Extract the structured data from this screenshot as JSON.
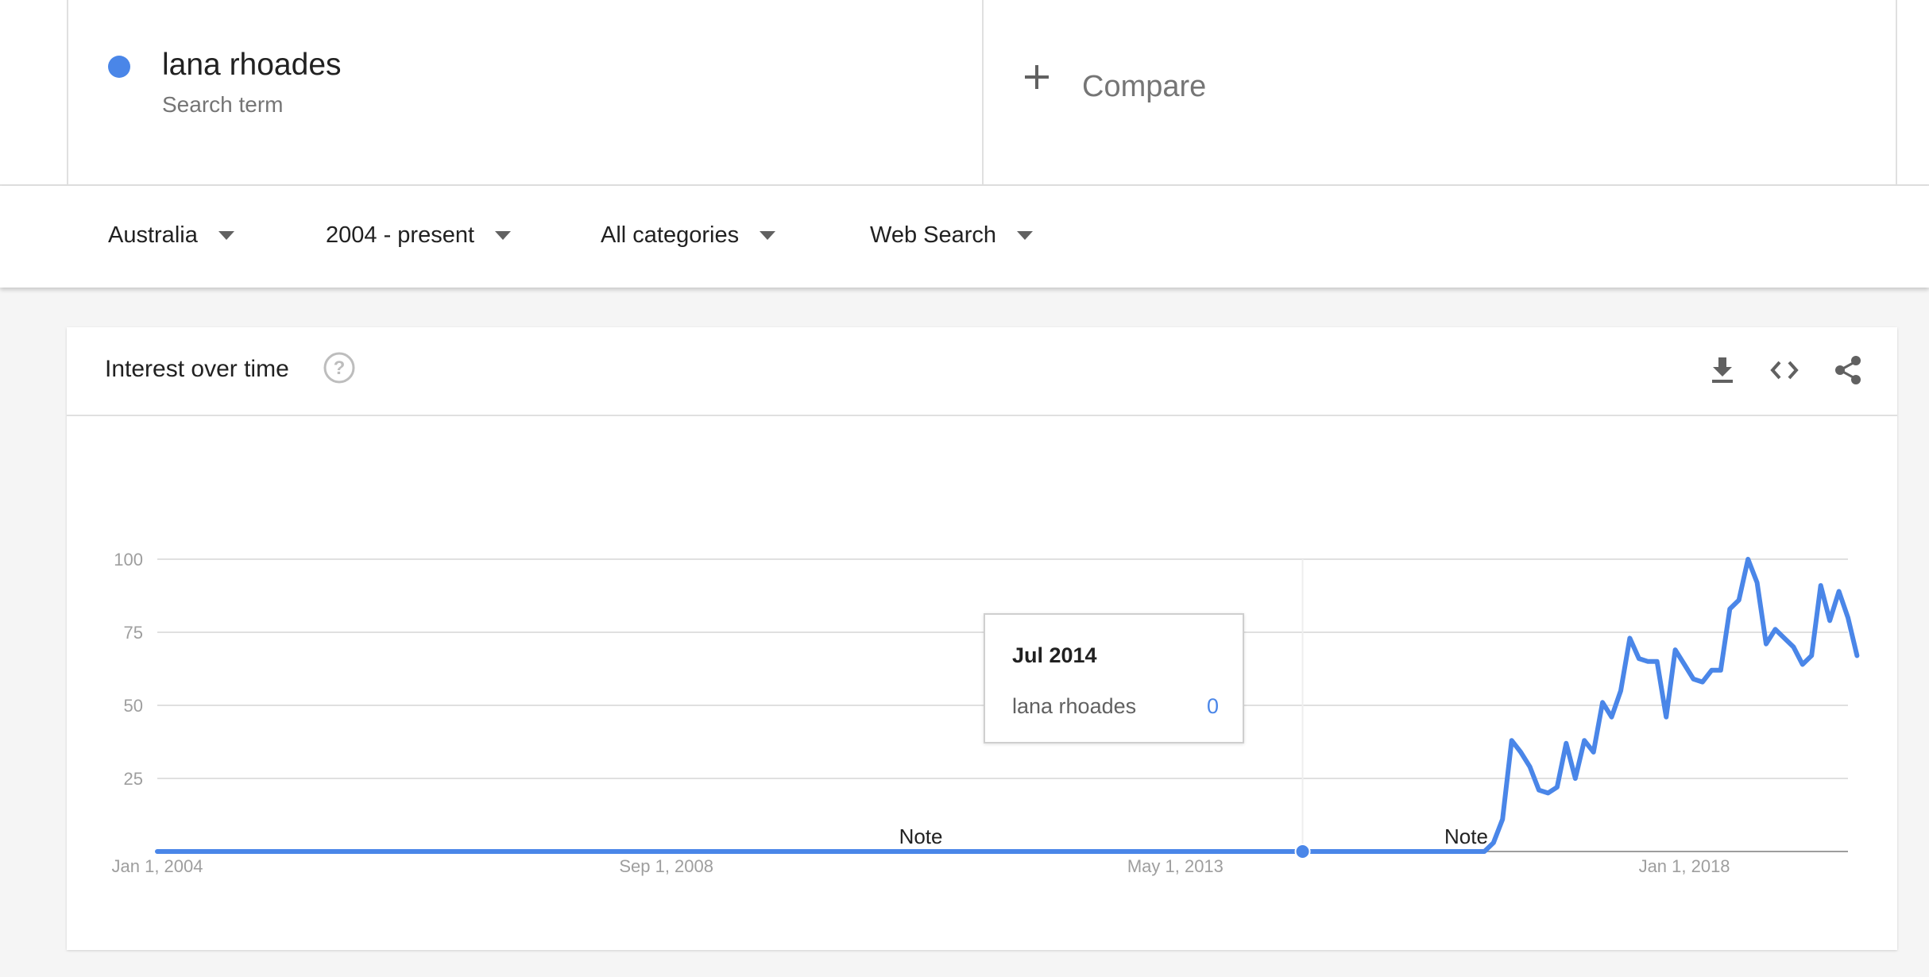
{
  "search_term": {
    "name": "lana rhoades",
    "subtitle": "Search term",
    "color": "#4a86e8"
  },
  "compare": {
    "label": "Compare"
  },
  "filters": {
    "region": "Australia",
    "time_range": "2004 - present",
    "category": "All categories",
    "search_type": "Web Search"
  },
  "card": {
    "title": "Interest over time",
    "icons": [
      "help-icon",
      "download-icon",
      "embed-code-icon",
      "share-icon"
    ]
  },
  "tooltip": {
    "date": "Jul 2014",
    "term": "lana rhoades",
    "value": "0"
  },
  "chart_data": {
    "type": "line",
    "title": "",
    "xlabel": "",
    "ylabel": "",
    "ylim": [
      0,
      100
    ],
    "yticks": [
      25,
      50,
      75,
      100
    ],
    "xticks": [
      "Jan 1, 2004",
      "Sep 1, 2008",
      "May 1, 2013",
      "Jan 1, 2018"
    ],
    "xrange": [
      "2004-01",
      "2019-04"
    ],
    "grid": true,
    "notes": [
      {
        "label": "Note",
        "date": "2011-01"
      },
      {
        "label": "Note",
        "date": "2016-01"
      }
    ],
    "highlight": {
      "date": "2014-07",
      "value": 0
    },
    "series": [
      {
        "name": "lana rhoades",
        "color": "#4a86e8",
        "points": [
          [
            "2004-01",
            0
          ],
          [
            "2016-02",
            0
          ],
          [
            "2016-03",
            0
          ],
          [
            "2016-04",
            3
          ],
          [
            "2016-05",
            11
          ],
          [
            "2016-06",
            38
          ],
          [
            "2016-07",
            34
          ],
          [
            "2016-08",
            29
          ],
          [
            "2016-09",
            21
          ],
          [
            "2016-10",
            20
          ],
          [
            "2016-11",
            22
          ],
          [
            "2016-12",
            37
          ],
          [
            "2017-01",
            25
          ],
          [
            "2017-02",
            38
          ],
          [
            "2017-03",
            34
          ],
          [
            "2017-04",
            51
          ],
          [
            "2017-05",
            46
          ],
          [
            "2017-06",
            55
          ],
          [
            "2017-07",
            73
          ],
          [
            "2017-08",
            66
          ],
          [
            "2017-09",
            65
          ],
          [
            "2017-10",
            65
          ],
          [
            "2017-11",
            46
          ],
          [
            "2017-12",
            69
          ],
          [
            "2018-01",
            64
          ],
          [
            "2018-02",
            59
          ],
          [
            "2018-03",
            58
          ],
          [
            "2018-04",
            62
          ],
          [
            "2018-05",
            62
          ],
          [
            "2018-06",
            83
          ],
          [
            "2018-07",
            86
          ],
          [
            "2018-08",
            100
          ],
          [
            "2018-09",
            92
          ],
          [
            "2018-10",
            71
          ],
          [
            "2018-11",
            76
          ],
          [
            "2018-12",
            73
          ],
          [
            "2019-01",
            70
          ],
          [
            "2019-02",
            64
          ],
          [
            "2019-03",
            67
          ],
          [
            "2019-04",
            91
          ],
          [
            "2019-05",
            79
          ],
          [
            "2019-06",
            89
          ],
          [
            "2019-07",
            80
          ],
          [
            "2019-08",
            67
          ]
        ]
      }
    ]
  }
}
